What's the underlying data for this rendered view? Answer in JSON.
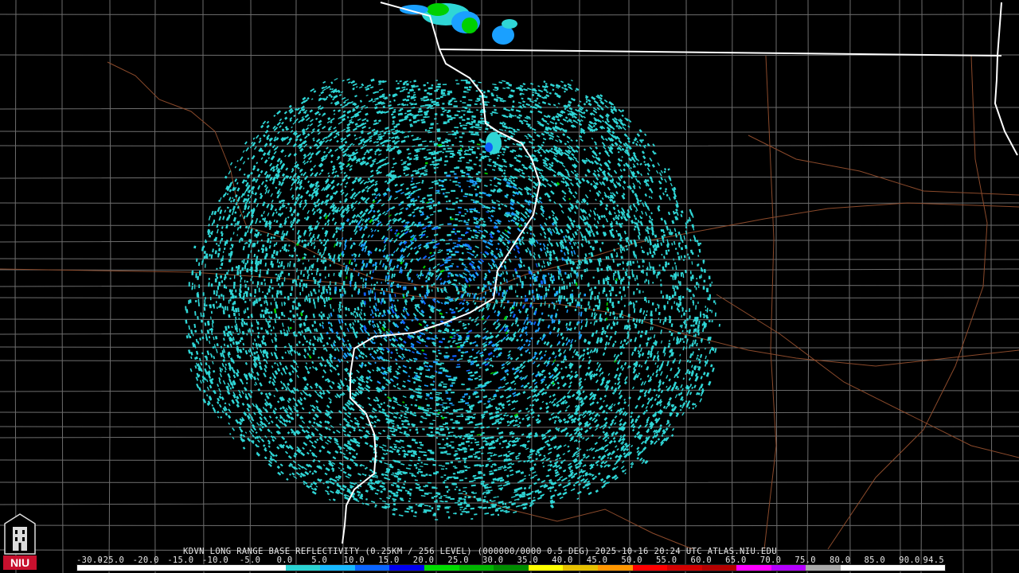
{
  "product": {
    "caption": "KDVN LONG RANGE BASE REFLECTIVITY (0.25KM / 256 LEVEL) (000000/0000 0.5 DEG) 2025-10-16 20:24 UTC   ATLAS.NIU.EDU"
  },
  "logo": {
    "text": "NIU",
    "color": "#c8102e"
  },
  "colorbar": {
    "labels": [
      "-30.0",
      "-25.0",
      "-20.0",
      "-15.0",
      "-10.0",
      "-5.0",
      "0.0",
      "5.0",
      "10.0",
      "15.0",
      "20.0",
      "25.0",
      "30.0",
      "35.0",
      "40.0",
      "45.0",
      "50.0",
      "55.0",
      "60.0",
      "65.0",
      "70.0",
      "75.0",
      "80.0",
      "85.0",
      "90.0",
      "94.5"
    ],
    "colors": [
      "#ffffff",
      "#ffffff",
      "#ffffff",
      "#ffffff",
      "#ffffff",
      "#ffffff",
      "#2bd2d2",
      "#18b8ff",
      "#0a64ff",
      "#0000f0",
      "#00dc00",
      "#00b400",
      "#008c00",
      "#ffff00",
      "#e6c000",
      "#ff9600",
      "#ff0000",
      "#d20000",
      "#b40000",
      "#ff00ff",
      "#b400ff",
      "#aaaaaa",
      "#ffffff",
      "#ffffff",
      "#ffffff"
    ]
  },
  "map": {
    "radar_site": "KDVN",
    "colors": {
      "background": "#000000",
      "county_lines": "#6e6e6e",
      "roads": "#8b4a2b",
      "state_borders": "#ffffff",
      "echo_light": "#2fd6d6",
      "echo_medium": "#1aa0ff",
      "echo_strong": "#1060ff",
      "echo_green": "#00d000",
      "site_marker": "#000000"
    }
  }
}
